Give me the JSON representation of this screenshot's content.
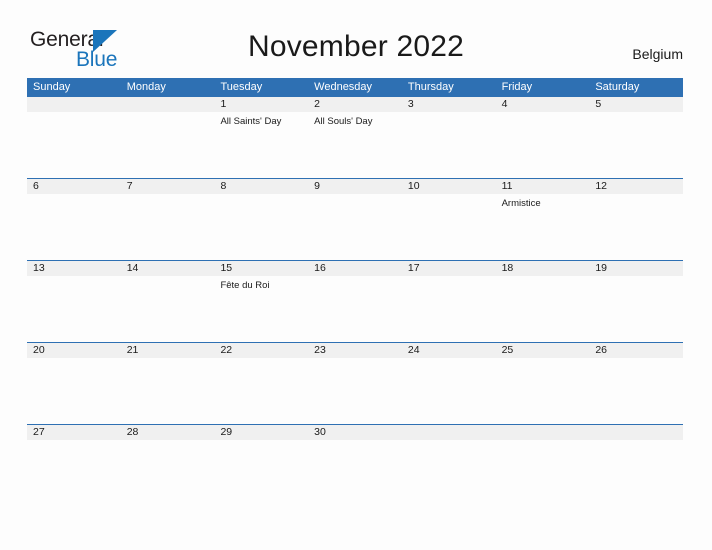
{
  "brand": {
    "name_part1": "General",
    "name_part2": "Blue",
    "flag_icon": "flag-triangle-icon",
    "accent_color": "#1b75bb"
  },
  "header": {
    "title": "November 2022",
    "country": "Belgium"
  },
  "theme": {
    "header_blue": "#2e70b3",
    "row_band_gray": "#f0f0f0",
    "page_background": "#fdfdfd",
    "text_color": "#1a1a1a"
  },
  "calendar": {
    "month": "November",
    "year": "2022",
    "weekday_headers": [
      "Sunday",
      "Monday",
      "Tuesday",
      "Wednesday",
      "Thursday",
      "Friday",
      "Saturday"
    ],
    "weeks": [
      {
        "days": [
          {
            "number": "",
            "event": ""
          },
          {
            "number": "",
            "event": ""
          },
          {
            "number": "1",
            "event": "All Saints' Day"
          },
          {
            "number": "2",
            "event": "All Souls' Day"
          },
          {
            "number": "3",
            "event": ""
          },
          {
            "number": "4",
            "event": ""
          },
          {
            "number": "5",
            "event": ""
          }
        ]
      },
      {
        "days": [
          {
            "number": "6",
            "event": ""
          },
          {
            "number": "7",
            "event": ""
          },
          {
            "number": "8",
            "event": ""
          },
          {
            "number": "9",
            "event": ""
          },
          {
            "number": "10",
            "event": ""
          },
          {
            "number": "11",
            "event": "Armistice"
          },
          {
            "number": "12",
            "event": ""
          }
        ]
      },
      {
        "days": [
          {
            "number": "13",
            "event": ""
          },
          {
            "number": "14",
            "event": ""
          },
          {
            "number": "15",
            "event": "Fête du Roi"
          },
          {
            "number": "16",
            "event": ""
          },
          {
            "number": "17",
            "event": ""
          },
          {
            "number": "18",
            "event": ""
          },
          {
            "number": "19",
            "event": ""
          }
        ]
      },
      {
        "days": [
          {
            "number": "20",
            "event": ""
          },
          {
            "number": "21",
            "event": ""
          },
          {
            "number": "22",
            "event": ""
          },
          {
            "number": "23",
            "event": ""
          },
          {
            "number": "24",
            "event": ""
          },
          {
            "number": "25",
            "event": ""
          },
          {
            "number": "26",
            "event": ""
          }
        ]
      },
      {
        "days": [
          {
            "number": "27",
            "event": ""
          },
          {
            "number": "28",
            "event": ""
          },
          {
            "number": "29",
            "event": ""
          },
          {
            "number": "30",
            "event": ""
          },
          {
            "number": "",
            "event": ""
          },
          {
            "number": "",
            "event": ""
          },
          {
            "number": "",
            "event": ""
          }
        ]
      }
    ]
  }
}
